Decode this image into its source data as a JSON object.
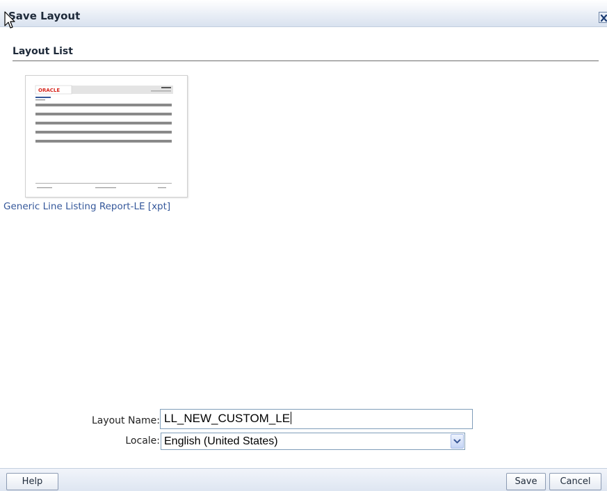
{
  "dialog": {
    "title": "Save Layout"
  },
  "layout_list": {
    "heading": "Layout List",
    "items": [
      {
        "label": "Generic Line Listing Report-LE [xpt]",
        "thumbnail_logo": "ORACLE"
      }
    ]
  },
  "form": {
    "layout_name_label": "Layout Name:",
    "layout_name_value": "LL_NEW_CUSTOM_LE",
    "locale_label": "Locale:",
    "locale_value": "English (United States)"
  },
  "footer": {
    "help_label": "Help",
    "save_label": "Save",
    "cancel_label": "Cancel"
  },
  "icons": {
    "close": "close-icon",
    "cursor": "mouse-cursor-icon",
    "dropdown": "chevron-down-icon"
  },
  "colors": {
    "accent": "#34579a",
    "logo_red": "#d7281f"
  }
}
